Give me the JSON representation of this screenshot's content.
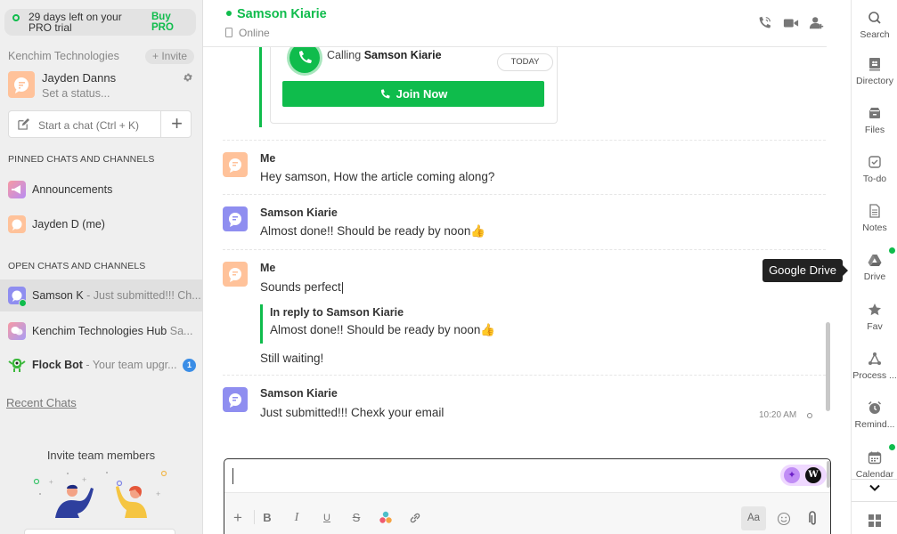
{
  "trial": {
    "text": "29 days left on your PRO trial",
    "cta": "Buy PRO"
  },
  "sidebar": {
    "org_name": "Kenchim Technologies",
    "invite_label": "+ Invite",
    "profile": {
      "name": "Jayden Danns",
      "status_placeholder": "Set a status..."
    },
    "start_chat_placeholder": "Start a chat (Ctrl + K)",
    "pinned_title": "PINNED CHATS AND CHANNELS",
    "pinned": [
      {
        "name": "Announcements",
        "icon": "megaphone-icon"
      },
      {
        "name": "Jayden D (me)",
        "icon": "chat-avatar-icon"
      }
    ],
    "open_title": "OPEN CHATS AND CHANNELS",
    "open": [
      {
        "name": "Samson K",
        "preview": " - Just submitted!!! Ch...",
        "online": true,
        "active": true
      },
      {
        "name": "Kenchim Technologies Hub",
        "preview": " Sa...",
        "online": false
      },
      {
        "name": "Flock Bot",
        "preview": " - Your team upgr...",
        "badge": "1",
        "bold": true
      }
    ],
    "recent_chats": "Recent Chats",
    "invite_team_title": "Invite team members"
  },
  "chat": {
    "contact_name": "Samson Kiarie",
    "contact_status": "Online",
    "call": {
      "prefix": "Calling ",
      "name": "Samson Kiarie",
      "date_badge": "TODAY",
      "join_label": "Join Now"
    },
    "messages": [
      {
        "sender": "Me",
        "text": "Hey samson, How the article coming along?",
        "avatar_color": "#ffc29a"
      },
      {
        "sender": "Samson Kiarie",
        "text": "Almost done!! Should be ready by noon👍",
        "avatar_color": "#8f8ef0"
      },
      {
        "sender": "Me",
        "text": "Sounds perfect|",
        "avatar_color": "#ffc29a",
        "reply": {
          "label": "In reply to Samson Kiarie",
          "quote": "Almost done!! Should be ready by noon👍"
        },
        "followup": "Still waiting!"
      },
      {
        "sender": "Samson Kiarie",
        "text": "Just submitted!!! Chexk your email",
        "avatar_color": "#8f8ef0",
        "time": "10:20 AM"
      }
    ],
    "composer": {
      "value": "",
      "format_toggle": "Aa",
      "writer_badge": "W"
    }
  },
  "tooltip": "Google Drive",
  "rail": {
    "items": [
      {
        "label": "Search",
        "icon": "search-icon"
      },
      {
        "label": "Directory",
        "icon": "directory-icon"
      },
      {
        "label": "Files",
        "icon": "files-icon"
      },
      {
        "label": "To-do",
        "icon": "todo-icon"
      },
      {
        "label": "Notes",
        "icon": "notes-icon"
      },
      {
        "label": "Drive",
        "icon": "drive-icon",
        "dot": true
      },
      {
        "label": "Fav",
        "icon": "star-icon"
      },
      {
        "label": "Process ...",
        "icon": "process-icon"
      },
      {
        "label": "Remind...",
        "icon": "alarm-icon"
      },
      {
        "label": "Calendar",
        "icon": "calendar-icon",
        "dot": true
      }
    ]
  },
  "colors": {
    "brand_green": "#0fbc4c",
    "badge_blue": "#3a8de6",
    "me_avatar": "#ffc29a",
    "contact_avatar": "#8f8ef0"
  }
}
